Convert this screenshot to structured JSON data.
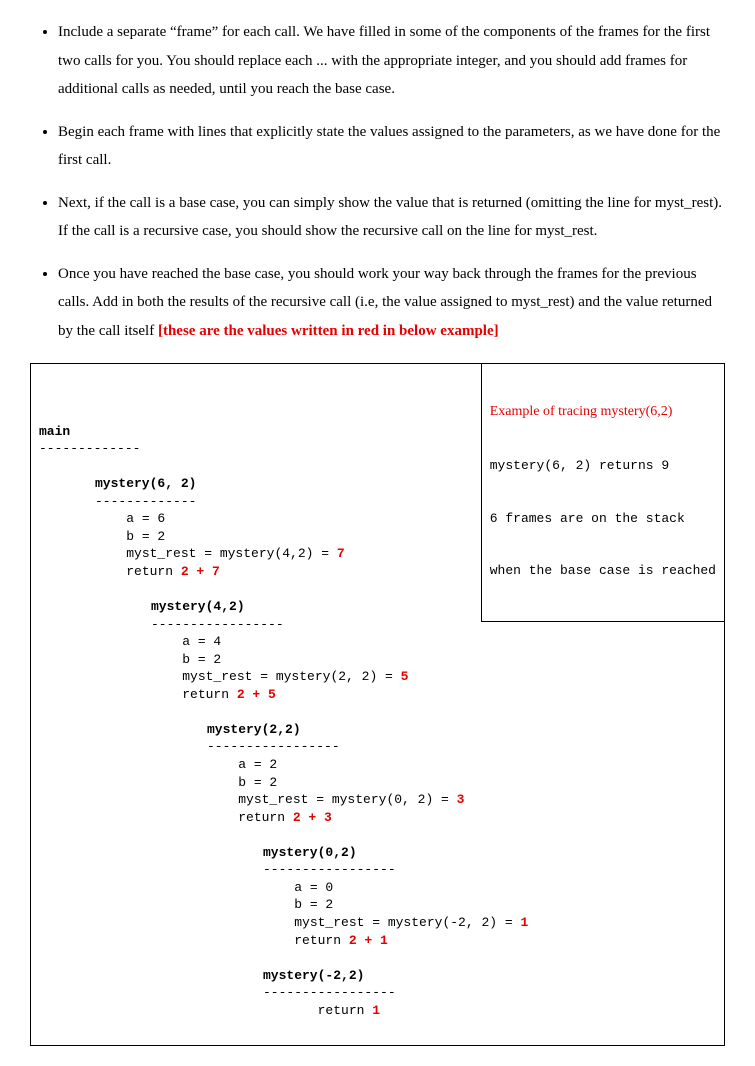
{
  "bullets": [
    {
      "text": "Include a separate “frame” for each call. We have filled in some of the components of the frames for the first two calls for you. You should replace each ... with the appropriate integer, and you should add frames for additional calls as needed, until you reach the base case."
    },
    {
      "text": "Begin each frame with lines that explicitly state the values assigned to the parameters, as we have done for the first call."
    },
    {
      "text": "Next, if the call is a base case, you can simply show the value that is returned (omitting the line for myst_rest). If the call is a recursive case, you should show the recursive call on the line for myst_rest."
    },
    {
      "text": "Once you have reached the base case, you should work your way back through the frames for the previous calls. Add in both the results of the recursive call (i.e, the value assigned to myst_rest) and the value returned by the call itself ",
      "red": "[these are the values written in red in below example]"
    }
  ],
  "example": {
    "title": "Example of tracing mystery(6,2)",
    "line1": "mystery(6, 2) returns 9",
    "line2": "6 frames are on the stack",
    "line3": "when the base case is reached"
  },
  "trace": {
    "main": "main",
    "dash_main": "-------------",
    "f1": {
      "call": "mystery(6, 2)",
      "dash": "-------------",
      "a": "a = 6",
      "b": "b = 2",
      "rest_pre": "myst_rest = mystery(4,2) = ",
      "rest_val": "7",
      "ret_pre": "return ",
      "ret_val": "2 + 7"
    },
    "f2": {
      "call": "mystery(4,2)",
      "dash": "-----------------",
      "a": "a = 4",
      "b": "b = 2",
      "rest_pre": "myst_rest = mystery(2, 2) = ",
      "rest_val": "5",
      "ret_pre": "return ",
      "ret_val": "2 + 5"
    },
    "f3": {
      "call": "mystery(2,2)",
      "dash": "-----------------",
      "a": "a = 2",
      "b": "b = 2",
      "rest_pre": "myst_rest = mystery(0, 2) = ",
      "rest_val": "3",
      "ret_pre": "return ",
      "ret_val": "2 + 3"
    },
    "f4": {
      "call": "mystery(0,2)",
      "dash": "-----------------",
      "a": "a = 0",
      "b": "b = 2",
      "rest_pre": "myst_rest = mystery(-2, 2) = ",
      "rest_val": "1",
      "ret_pre": "return ",
      "ret_val": "2 + 1"
    },
    "f5": {
      "call": "mystery(-2,2)",
      "dash": "-----------------",
      "ret_pre": "return ",
      "ret_val": "1"
    }
  }
}
